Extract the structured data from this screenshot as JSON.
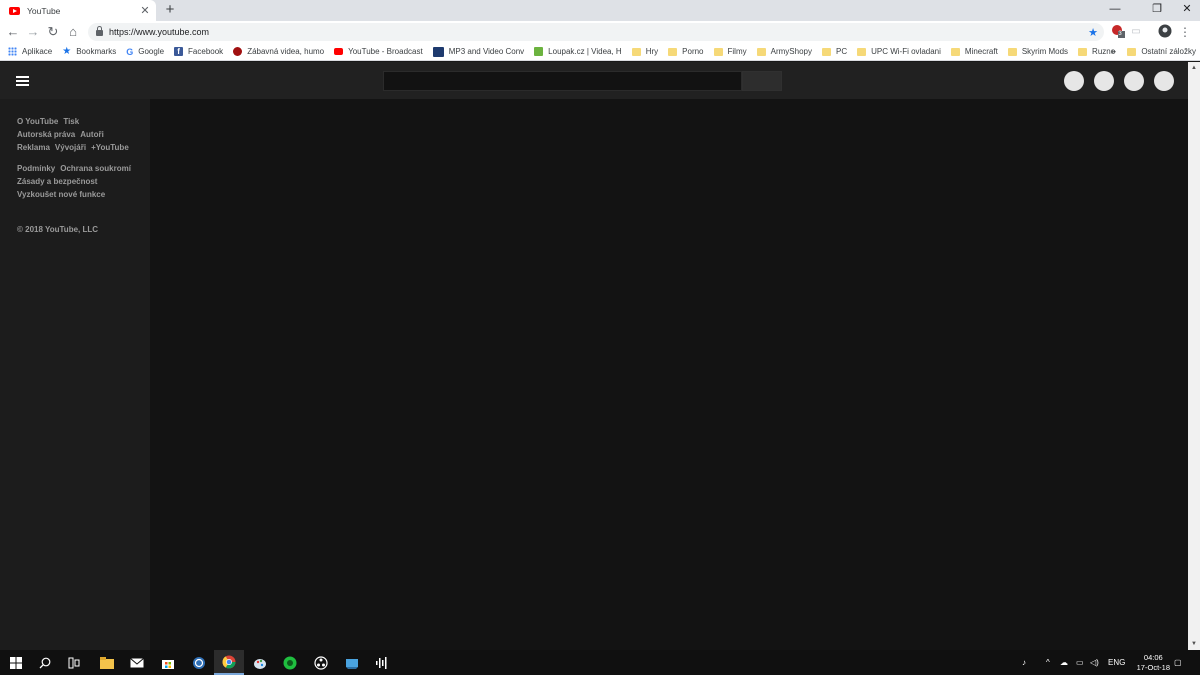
{
  "browser": {
    "tab": {
      "title": "YouTube",
      "close": "✕"
    },
    "new_tab": "+",
    "window_controls": {
      "minimize": "—",
      "restore": "❐",
      "close": "✕"
    },
    "nav": {
      "back": "←",
      "forward": "→",
      "reload": "↻",
      "home": "⌂"
    },
    "url": "https://www.youtube.com",
    "extension_badge": "3",
    "menu": "⋮"
  },
  "bookmarks": {
    "items": [
      {
        "label": "Aplikace",
        "icon": "apps-icon",
        "color": "#4285f4"
      },
      {
        "label": "Bookmarks",
        "icon": "star-icon",
        "color": "#1a73e8"
      },
      {
        "label": "Google",
        "icon": "google-icon",
        "color": "#4285f4"
      },
      {
        "label": "Facebook",
        "icon": "facebook-icon",
        "color": "#3b5998"
      },
      {
        "label": "Zábavná videa, humo",
        "icon": "bug-icon",
        "color": "#a01010"
      },
      {
        "label": "YouTube - Broadcast",
        "icon": "youtube-icon",
        "color": "#ff0000"
      },
      {
        "label": "MP3 and Video Conv",
        "icon": "mp3-icon",
        "color": "#1e3a6e"
      },
      {
        "label": "Loupak.cz | Videa, H",
        "icon": "loupak-icon",
        "color": "#6cb33f"
      },
      {
        "label": "Hry",
        "icon": "folder-icon",
        "color": "#f6d978"
      },
      {
        "label": "Porno",
        "icon": "folder-icon",
        "color": "#f6d978"
      },
      {
        "label": "Filmy",
        "icon": "folder-icon",
        "color": "#f6d978"
      },
      {
        "label": "ArmyShopy",
        "icon": "folder-icon",
        "color": "#f6d978"
      },
      {
        "label": "PC",
        "icon": "folder-icon",
        "color": "#f6d978"
      },
      {
        "label": "UPC Wi-Fi ovladani",
        "icon": "folder-icon",
        "color": "#f6d978"
      },
      {
        "label": "Minecraft",
        "icon": "folder-icon",
        "color": "#f6d978"
      },
      {
        "label": "Skyrim Mods",
        "icon": "folder-icon",
        "color": "#f6d978"
      },
      {
        "label": "Ruzne",
        "icon": "folder-icon",
        "color": "#f6d978"
      }
    ],
    "more": "»",
    "other": "Ostatní záložky"
  },
  "sidebar": {
    "row1": [
      "O YouTube",
      "Tisk"
    ],
    "row2": [
      "Autorská práva",
      "Autoři"
    ],
    "row3": [
      "Reklama",
      "Vývojáři",
      "+YouTube"
    ],
    "row4": [
      "Podmínky",
      "Ochrana soukromí"
    ],
    "row5": [
      "Zásady a bezpečnost"
    ],
    "row6": [
      "Vyzkoušet nové funkce"
    ],
    "copyright": "© 2018 YouTube, LLC"
  },
  "taskbar": {
    "tray_lang": "ENG",
    "time": "04:06",
    "date": "17-Oct-18"
  },
  "colors": {
    "masthead": "#212121",
    "sidebar": "#1c1c1c",
    "content": "#131313",
    "youtube_red": "#ff0000"
  }
}
